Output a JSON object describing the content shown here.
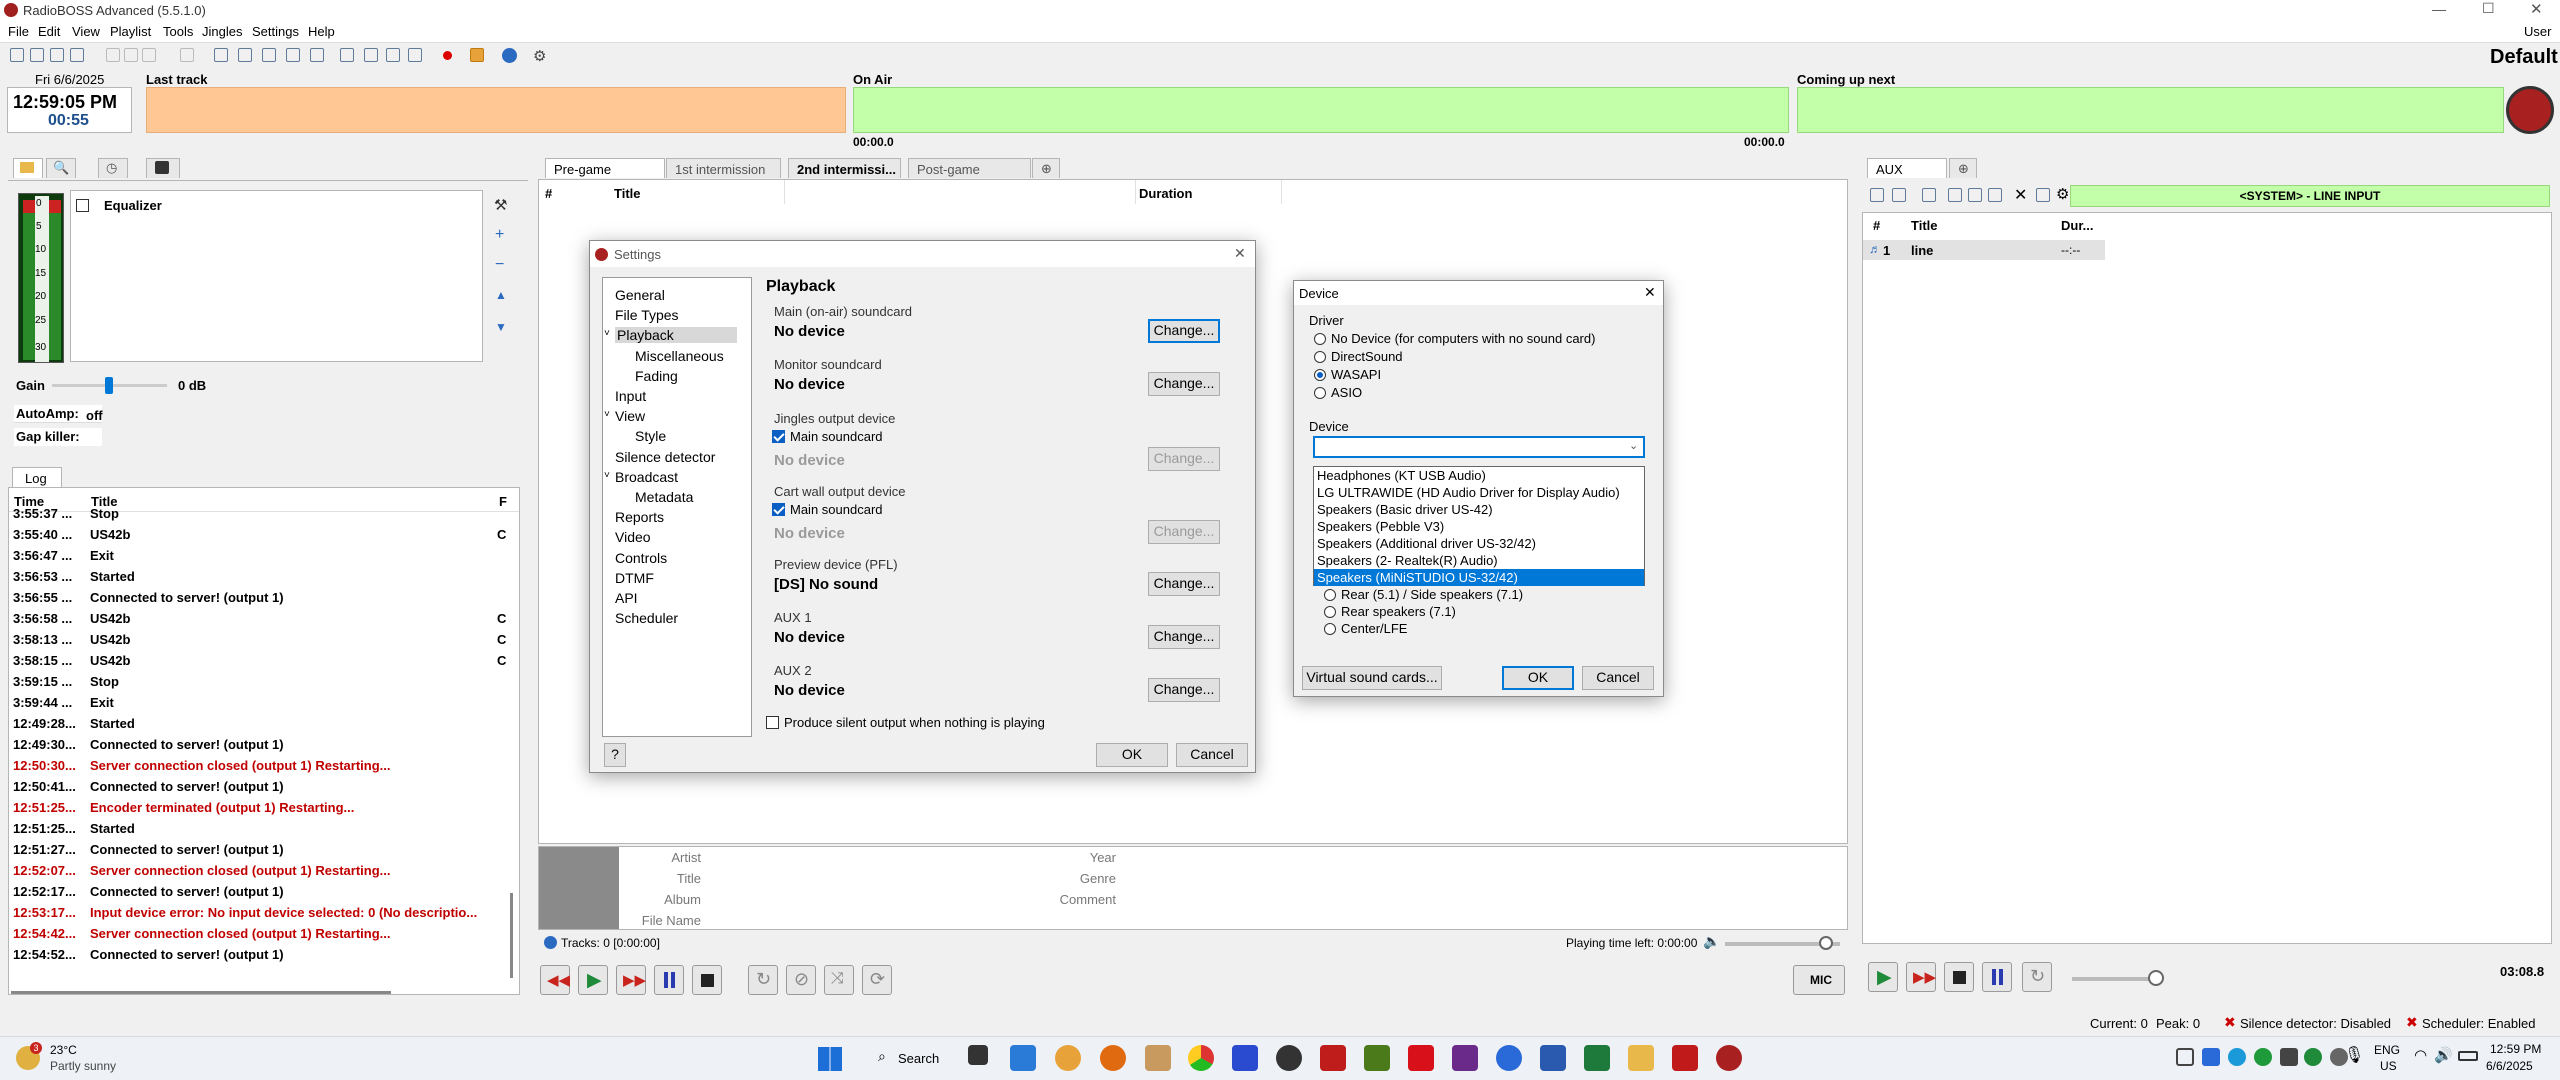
{
  "app": {
    "title": "RadioBOSS Advanced (5.5.1.0)",
    "user_label": "User",
    "profile": "Default"
  },
  "menu": [
    "File",
    "Edit",
    "View",
    "Playlist",
    "Tools",
    "Jingles",
    "Settings",
    "Help"
  ],
  "clock": {
    "date": "Fri 6/6/2025",
    "time": "12:59:05 PM",
    "counter": "00:55"
  },
  "top": {
    "last_track": "Last track",
    "on_air": "On Air",
    "coming_up": "Coming up next",
    "on_air_time": "00:00.0",
    "on_air_remaining": "00:00.0"
  },
  "left": {
    "vu_scale": [
      "0",
      "5",
      "10",
      "15",
      "20",
      "25",
      "30"
    ],
    "equalizer_label": "Equalizer",
    "gain_label": "Gain",
    "gain_value": "0 dB",
    "autoamp_label": "AutoAmp:",
    "autoamp_value": "off",
    "gapkiller_label": "Gap killer:"
  },
  "log": {
    "tab": "Log",
    "headers": [
      "Time",
      "Title",
      "F"
    ],
    "rows": [
      {
        "time": "3:55:37 ...",
        "title": "Stop",
        "err": false,
        "f": ""
      },
      {
        "time": "3:55:40 ...",
        "title": "US42b",
        "err": false,
        "f": "C"
      },
      {
        "time": "3:56:47 ...",
        "title": "Exit",
        "err": false,
        "f": ""
      },
      {
        "time": "3:56:53 ...",
        "title": "Started",
        "err": false,
        "f": ""
      },
      {
        "time": "3:56:55 ...",
        "title": "Connected to server! (output 1)",
        "err": false,
        "f": ""
      },
      {
        "time": "3:56:58 ...",
        "title": "US42b",
        "err": false,
        "f": "C"
      },
      {
        "time": "3:58:13 ...",
        "title": "US42b",
        "err": false,
        "f": "C"
      },
      {
        "time": "3:58:15 ...",
        "title": "US42b",
        "err": false,
        "f": "C"
      },
      {
        "time": "3:59:15 ...",
        "title": "Stop",
        "err": false,
        "f": ""
      },
      {
        "time": "3:59:44 ...",
        "title": "Exit",
        "err": false,
        "f": ""
      },
      {
        "time": "12:49:28...",
        "title": "Started",
        "err": false,
        "f": ""
      },
      {
        "time": "12:49:30...",
        "title": "Connected to server! (output 1)",
        "err": false,
        "f": ""
      },
      {
        "time": "12:50:30...",
        "title": "Server connection closed (output 1) Restarting...",
        "err": true,
        "f": ""
      },
      {
        "time": "12:50:41...",
        "title": "Connected to server! (output 1)",
        "err": false,
        "f": ""
      },
      {
        "time": "12:51:25...",
        "title": "Encoder terminated (output 1) Restarting...",
        "err": true,
        "f": ""
      },
      {
        "time": "12:51:25...",
        "title": "Started",
        "err": false,
        "f": ""
      },
      {
        "time": "12:51:27...",
        "title": "Connected to server! (output 1)",
        "err": false,
        "f": ""
      },
      {
        "time": "12:52:07...",
        "title": "Server connection closed (output 1) Restarting...",
        "err": true,
        "f": ""
      },
      {
        "time": "12:52:17...",
        "title": "Connected to server! (output 1)",
        "err": false,
        "f": ""
      },
      {
        "time": "12:53:17...",
        "title": "Input device error: No input device selected: 0 (No descriptio...",
        "err": true,
        "f": ""
      },
      {
        "time": "12:54:42...",
        "title": "Server connection closed (output 1) Restarting...",
        "err": true,
        "f": ""
      },
      {
        "time": "12:54:52...",
        "title": "Connected to server! (output 1)",
        "err": false,
        "f": ""
      }
    ]
  },
  "playlist": {
    "tabs": [
      "Pre-game",
      "1st intermission",
      "2nd intermissi...",
      "Post-game"
    ],
    "headers": [
      "#",
      "Title",
      "Duration"
    ],
    "meta_labels": [
      "Artist",
      "Title",
      "Album",
      "File Name"
    ],
    "meta_labels2": [
      "Year",
      "Genre",
      "Comment"
    ],
    "tracks_status": "Tracks: 0 [0:00:00]",
    "time_left": "Playing time left: 0:00:00",
    "mic_label": "MIC"
  },
  "settings": {
    "title": "Settings",
    "tree": [
      {
        "label": "General",
        "indent": 0,
        "arrow": ""
      },
      {
        "label": "File Types",
        "indent": 0,
        "arrow": ""
      },
      {
        "label": "Playback",
        "indent": 0,
        "arrow": "v",
        "selected": true
      },
      {
        "label": "Miscellaneous",
        "indent": 1,
        "arrow": ""
      },
      {
        "label": "Fading",
        "indent": 1,
        "arrow": ""
      },
      {
        "label": "Input",
        "indent": 0,
        "arrow": ""
      },
      {
        "label": "View",
        "indent": 0,
        "arrow": "v"
      },
      {
        "label": "Style",
        "indent": 1,
        "arrow": ""
      },
      {
        "label": "Silence detector",
        "indent": 0,
        "arrow": ""
      },
      {
        "label": "Broadcast",
        "indent": 0,
        "arrow": "v"
      },
      {
        "label": "Metadata",
        "indent": 1,
        "arrow": ""
      },
      {
        "label": "Reports",
        "indent": 0,
        "arrow": ""
      },
      {
        "label": "Video",
        "indent": 0,
        "arrow": ""
      },
      {
        "label": "Controls",
        "indent": 0,
        "arrow": ""
      },
      {
        "label": "DTMF",
        "indent": 0,
        "arrow": ""
      },
      {
        "label": "API",
        "indent": 0,
        "arrow": ""
      },
      {
        "label": "Scheduler",
        "indent": 0,
        "arrow": ""
      }
    ],
    "heading": "Playback",
    "main_label": "Main (on-air) soundcard",
    "main_value": "No device",
    "monitor_label": "Monitor soundcard",
    "monitor_value": "No device",
    "jingles_label": "Jingles output device",
    "jingles_chk": "Main soundcard",
    "jingles_value": "No device",
    "cart_label": "Cart wall output device",
    "cart_chk": "Main soundcard",
    "cart_value": "No device",
    "pfl_label": "Preview device (PFL)",
    "pfl_value": "[DS] No sound",
    "aux1_label": "AUX 1",
    "aux1_value": "No device",
    "aux2_label": "AUX 2",
    "aux2_value": "No device",
    "change": "Change...",
    "silent_label": "Produce silent output when nothing is playing",
    "help": "?",
    "ok": "OK",
    "cancel": "Cancel"
  },
  "device": {
    "title": "Device",
    "driver_label": "Driver",
    "drivers": [
      "No Device (for computers with no sound card)",
      "DirectSound",
      "WASAPI",
      "ASIO"
    ],
    "selected_driver": 2,
    "device_label": "Device",
    "options": [
      "Headphones (KT USB Audio)",
      "LG ULTRAWIDE (HD Audio Driver for Display Audio)",
      "Speakers (Basic driver US-42)",
      "Speakers (Pebble V3)",
      "Speakers (Additional driver US-32/42)",
      "Speakers (2- Realtek(R) Audio)",
      "Speakers (MiNiSTUDIO US-32/42)"
    ],
    "selected_option": 6,
    "channels": [
      "Rear (5.1) / Side speakers (7.1)",
      "Rear speakers (7.1)",
      "Center/LFE"
    ],
    "virtual": "Virtual sound cards...",
    "ok": "OK",
    "cancel": "Cancel"
  },
  "aux": {
    "tab": "AUX",
    "input_label": "<SYSTEM> - LINE INPUT",
    "headers": [
      "#",
      "Title",
      "Dur..."
    ],
    "row_num": "1",
    "row_title": "line",
    "row_dur": "--:--",
    "time": "03:08.8"
  },
  "status": {
    "current": "Current: 0",
    "peak": "Peak: 0",
    "silence": "Silence detector: Disabled",
    "scheduler": "Scheduler: Enabled"
  },
  "taskbar": {
    "temp": "23°C",
    "weather": "Partly sunny",
    "weather_badge": "3",
    "search": "Search",
    "lang1": "ENG",
    "lang2": "US",
    "time": "12:59 PM",
    "date": "6/6/2025"
  }
}
